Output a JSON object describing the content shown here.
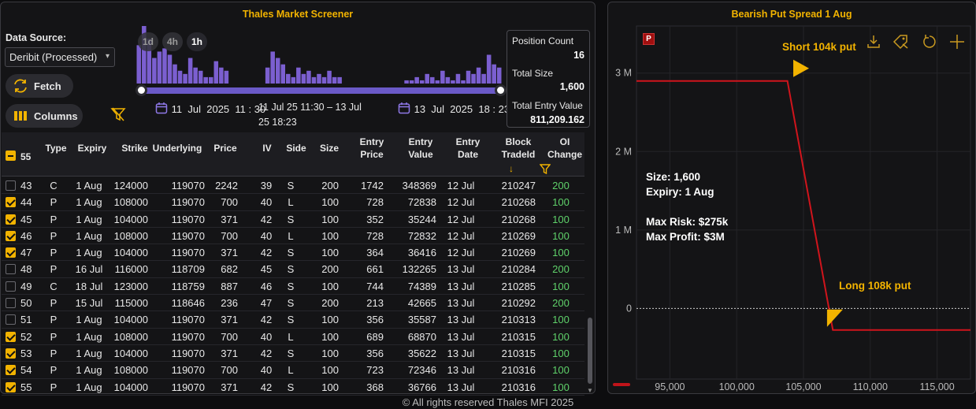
{
  "screener": {
    "title": "Thales Market Screener",
    "data_source_label": "Data Source:",
    "data_source_value": "Deribit (Processed)",
    "fetch_label": "Fetch",
    "columns_label": "Columns",
    "range_buttons": [
      "1d",
      "4h",
      "1h"
    ],
    "active_range": "1h",
    "histogram_counts": [
      12,
      18,
      14,
      8,
      10,
      11,
      9,
      6,
      4,
      3,
      8,
      5,
      4,
      2,
      2,
      7,
      5,
      4,
      0,
      0,
      0,
      0,
      0,
      0,
      0,
      5,
      10,
      8,
      6,
      3,
      2,
      5,
      3,
      4,
      2,
      3,
      2,
      4,
      2,
      2,
      0,
      0,
      0,
      0,
      0,
      0,
      0,
      0,
      0,
      0,
      0,
      0,
      1,
      1,
      2,
      1,
      3,
      2,
      1,
      4,
      2,
      1,
      3,
      1,
      4,
      3,
      5,
      3,
      9,
      6,
      5
    ],
    "start_date": "11  Jul  2025  11 : 30",
    "end_date": "13  Jul  2025  18 : 23",
    "range_text": "11 Jul 25 11:30 – 13 Jul 25 18:23",
    "stats": {
      "position_count_label": "Position Count",
      "position_count": "16",
      "total_size_label": "Total Size",
      "total_size": "1,600",
      "total_entry_value_label": "Total Entry Value",
      "total_entry_value": "811,209.162"
    },
    "selected_count": "55",
    "columns": [
      "Type",
      "Expiry",
      "Strike",
      "Underlying",
      "Price",
      "IV",
      "Side",
      "Size",
      "Entry Price",
      "Entry Value",
      "Entry Date",
      "Block TradeId",
      "OI Change"
    ],
    "sort_arrow": "↓",
    "rows": [
      {
        "id": "43",
        "checked": false,
        "type": "C",
        "expiry": "1 Aug",
        "strike": "124000",
        "underlying": "119070",
        "price": "2242",
        "iv": "39",
        "side": "S",
        "size": "200",
        "entry_price": "1742",
        "entry_value": "348369",
        "entry_date": "12 Jul",
        "trade_id": "210247",
        "oi": "200"
      },
      {
        "id": "44",
        "checked": true,
        "type": "P",
        "expiry": "1 Aug",
        "strike": "108000",
        "underlying": "119070",
        "price": "700",
        "iv": "40",
        "side": "L",
        "size": "100",
        "entry_price": "728",
        "entry_value": "72838",
        "entry_date": "12 Jul",
        "trade_id": "210268",
        "oi": "100"
      },
      {
        "id": "45",
        "checked": true,
        "type": "P",
        "expiry": "1 Aug",
        "strike": "104000",
        "underlying": "119070",
        "price": "371",
        "iv": "42",
        "side": "S",
        "size": "100",
        "entry_price": "352",
        "entry_value": "35244",
        "entry_date": "12 Jul",
        "trade_id": "210268",
        "oi": "100"
      },
      {
        "id": "46",
        "checked": true,
        "type": "P",
        "expiry": "1 Aug",
        "strike": "108000",
        "underlying": "119070",
        "price": "700",
        "iv": "40",
        "side": "L",
        "size": "100",
        "entry_price": "728",
        "entry_value": "72832",
        "entry_date": "12 Jul",
        "trade_id": "210269",
        "oi": "100"
      },
      {
        "id": "47",
        "checked": true,
        "type": "P",
        "expiry": "1 Aug",
        "strike": "104000",
        "underlying": "119070",
        "price": "371",
        "iv": "42",
        "side": "S",
        "size": "100",
        "entry_price": "364",
        "entry_value": "36416",
        "entry_date": "12 Jul",
        "trade_id": "210269",
        "oi": "100"
      },
      {
        "id": "48",
        "checked": false,
        "type": "P",
        "expiry": "16 Jul",
        "strike": "116000",
        "underlying": "118709",
        "price": "682",
        "iv": "45",
        "side": "S",
        "size": "200",
        "entry_price": "661",
        "entry_value": "132265",
        "entry_date": "13 Jul",
        "trade_id": "210284",
        "oi": "200"
      },
      {
        "id": "49",
        "checked": false,
        "type": "C",
        "expiry": "18 Jul",
        "strike": "123000",
        "underlying": "118759",
        "price": "887",
        "iv": "46",
        "side": "S",
        "size": "100",
        "entry_price": "744",
        "entry_value": "74389",
        "entry_date": "13 Jul",
        "trade_id": "210285",
        "oi": "100"
      },
      {
        "id": "50",
        "checked": false,
        "type": "P",
        "expiry": "15 Jul",
        "strike": "115000",
        "underlying": "118646",
        "price": "236",
        "iv": "47",
        "side": "S",
        "size": "200",
        "entry_price": "213",
        "entry_value": "42665",
        "entry_date": "13 Jul",
        "trade_id": "210292",
        "oi": "200"
      },
      {
        "id": "51",
        "checked": false,
        "type": "P",
        "expiry": "1 Aug",
        "strike": "104000",
        "underlying": "119070",
        "price": "371",
        "iv": "42",
        "side": "S",
        "size": "100",
        "entry_price": "356",
        "entry_value": "35587",
        "entry_date": "13 Jul",
        "trade_id": "210313",
        "oi": "100"
      },
      {
        "id": "52",
        "checked": true,
        "type": "P",
        "expiry": "1 Aug",
        "strike": "108000",
        "underlying": "119070",
        "price": "700",
        "iv": "40",
        "side": "L",
        "size": "100",
        "entry_price": "689",
        "entry_value": "68870",
        "entry_date": "13 Jul",
        "trade_id": "210315",
        "oi": "100"
      },
      {
        "id": "53",
        "checked": true,
        "type": "P",
        "expiry": "1 Aug",
        "strike": "104000",
        "underlying": "119070",
        "price": "371",
        "iv": "42",
        "side": "S",
        "size": "100",
        "entry_price": "356",
        "entry_value": "35622",
        "entry_date": "13 Jul",
        "trade_id": "210315",
        "oi": "100"
      },
      {
        "id": "54",
        "checked": true,
        "type": "P",
        "expiry": "1 Aug",
        "strike": "108000",
        "underlying": "119070",
        "price": "700",
        "iv": "40",
        "side": "L",
        "size": "100",
        "entry_price": "723",
        "entry_value": "72346",
        "entry_date": "13 Jul",
        "trade_id": "210316",
        "oi": "100"
      },
      {
        "id": "55",
        "checked": true,
        "type": "P",
        "expiry": "1 Aug",
        "strike": "104000",
        "underlying": "119070",
        "price": "371",
        "iv": "42",
        "side": "S",
        "size": "100",
        "entry_price": "368",
        "entry_value": "36766",
        "entry_date": "13 Jul",
        "trade_id": "210316",
        "oi": "100"
      }
    ]
  },
  "payoff": {
    "title": "Bearish Put Spread 1 Aug",
    "badge": "P",
    "info_lines": [
      "Size: 1,600",
      "Expiry: 1 Aug",
      "",
      "Max Risk: $275k",
      "Max Profit: $3M"
    ],
    "annotations": [
      {
        "text": "Short 104k put",
        "x": 104000,
        "y": 2900000
      },
      {
        "text": "Long 108k put",
        "x": 107000,
        "y": -275000
      }
    ]
  },
  "chart_data": {
    "type": "line",
    "title": "Bearish Put Spread 1 Aug",
    "x": [
      92500,
      103800,
      107200,
      117500
    ],
    "y": [
      2900000,
      2900000,
      -275000,
      -275000
    ],
    "xlim": [
      92500,
      117500
    ],
    "ylim": [
      -900000,
      3600000
    ],
    "xticks": [
      "95,000",
      "100,000",
      "105,000",
      "110,000",
      "115,000"
    ],
    "xtick_values": [
      95000,
      100000,
      105000,
      110000,
      115000
    ],
    "yticks": [
      "0",
      "1 M",
      "2 M",
      "3 M"
    ],
    "ytick_values": [
      0,
      1000000,
      2000000,
      3000000
    ],
    "zero_line": true,
    "grid": true,
    "line_color": "#d0141c"
  },
  "colors": {
    "accent": "#f2b300",
    "histogram": "#7b5fd0",
    "positive": "#5fd16a",
    "payoff_line": "#d0141c"
  },
  "footer": "© All rights reserved Thales MFI 2025"
}
